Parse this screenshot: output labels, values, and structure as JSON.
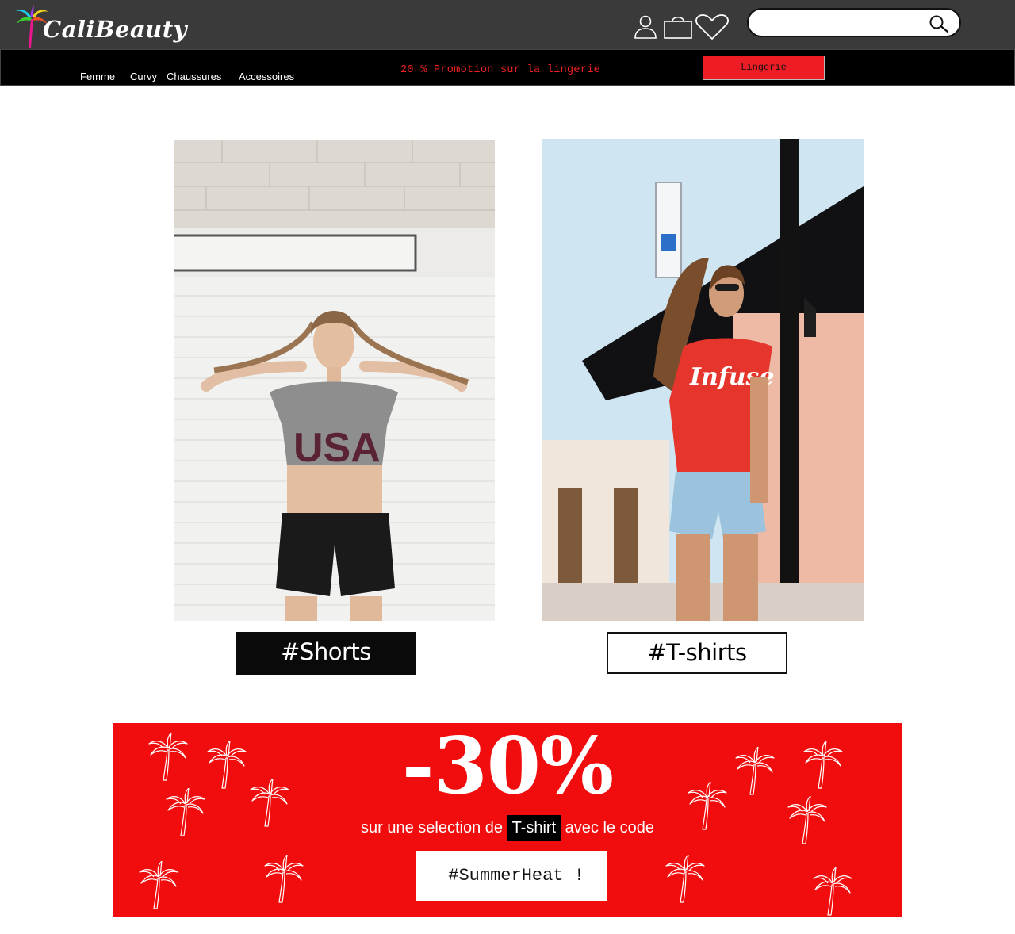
{
  "brand": {
    "name": "CaliBeauty"
  },
  "header": {
    "icons": [
      "user-icon",
      "shopping-bag-icon",
      "heart-icon"
    ],
    "search": {
      "placeholder": "",
      "value": ""
    }
  },
  "nav": {
    "items": [
      {
        "label": "Femme"
      },
      {
        "label": "Curvy"
      },
      {
        "label": "Chaussures"
      },
      {
        "label": "Accessoires"
      }
    ],
    "promo_text": "20 % Promotion sur la lingerie",
    "cta_label": "Lingerie"
  },
  "products": [
    {
      "tag": "#Shorts"
    },
    {
      "tag": "#T-shirts"
    }
  ],
  "banner": {
    "discount": "-30%",
    "line_before": "sur une selection de ",
    "highlight": "T-shirt",
    "line_after": " avec le code",
    "code": " #SummerHeat !",
    "bg_color": "#f10d0d"
  },
  "colors": {
    "accent": "#ee1c24",
    "header_bg": "#3a3a3a",
    "nav_bg": "#000000"
  }
}
